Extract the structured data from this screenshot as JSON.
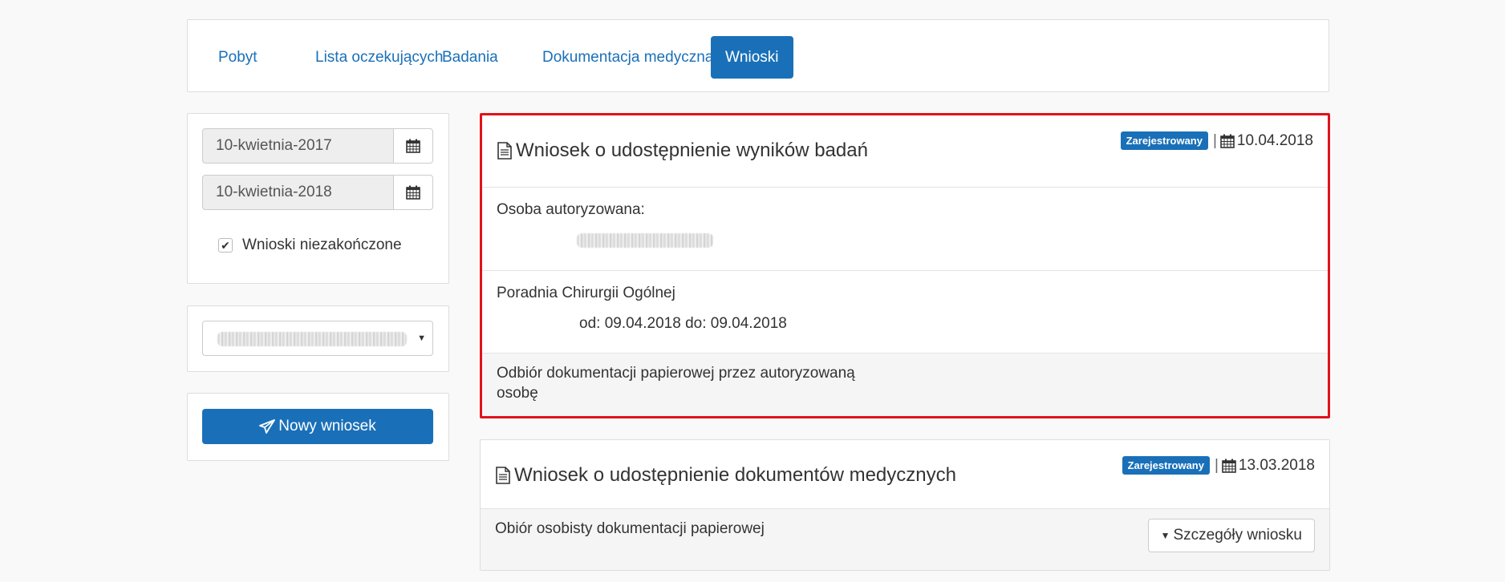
{
  "nav": {
    "tabs": [
      {
        "label": "Pobyt"
      },
      {
        "label": "Lista oczekujących"
      },
      {
        "label": "Badania"
      },
      {
        "label": "Dokumentacja medyczna"
      },
      {
        "label": "Wnioski"
      }
    ],
    "active_index": 4
  },
  "filters": {
    "date_from": "10-kwietnia-2017",
    "date_to": "10-kwietnia-2018",
    "checkbox_label": "Wnioski niezakończone",
    "checkbox_checked": true
  },
  "new_request_label": "Nowy wniosek",
  "requests": [
    {
      "title": "Wniosek o udostępnienie wyników badań",
      "status": "Zarejestrowany",
      "date": "10.04.2018",
      "authorized_label": "Osoba autoryzowana:",
      "clinic": "Poradnia Chirurgii Ogólnej",
      "period": "od: 09.04.2018 do: 09.04.2018",
      "pickup": "Odbiór dokumentacji papierowej przez autoryzowaną",
      "pickup_line2": "osobę"
    },
    {
      "title": "Wniosek o udostępnienie dokumentów medycznych",
      "status": "Zarejestrowany",
      "date": "13.03.2018",
      "pickup": "Obiór osobisty dokumentacji papierowej",
      "details_label": "Szczegóły wniosku"
    }
  ],
  "colors": {
    "accent": "#1a70b8",
    "highlight": "#e0121b"
  }
}
